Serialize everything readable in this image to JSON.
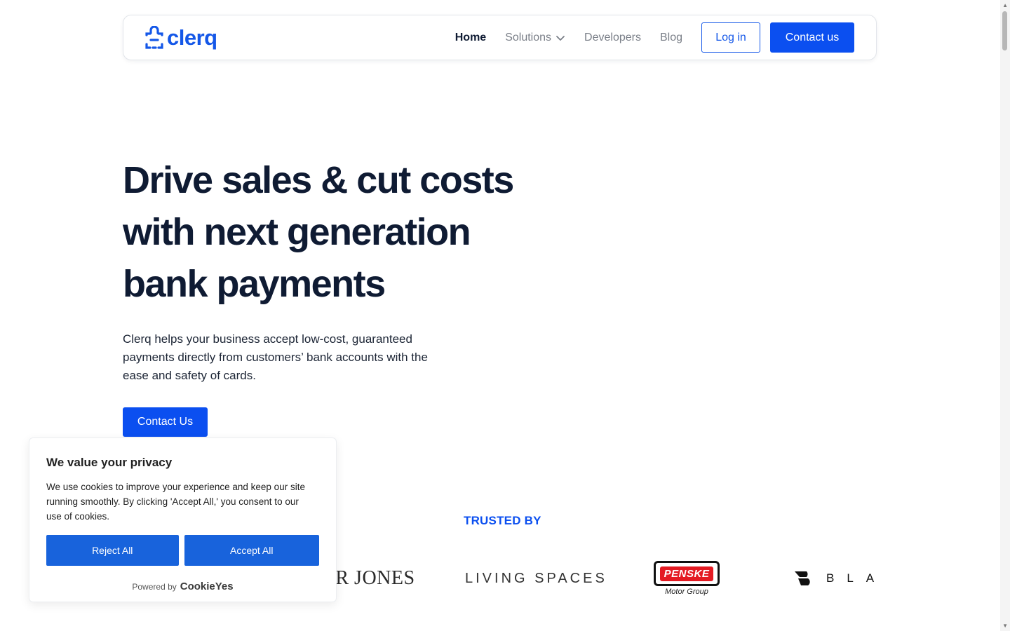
{
  "brand": {
    "name": "clerq",
    "color": "#1457e8"
  },
  "nav": {
    "links": [
      {
        "label": "Home",
        "active": true
      },
      {
        "label": "Solutions",
        "has_dropdown": true
      },
      {
        "label": "Developers"
      },
      {
        "label": "Blog"
      }
    ],
    "login_label": "Log in",
    "contact_label": "Contact us"
  },
  "hero": {
    "title_line1": "Drive sales & cut costs",
    "title_line2": "with next generation",
    "title_line3": "bank payments",
    "subtitle": "Clerq helps your business accept low-cost, guaranteed payments directly from customers’ bank accounts with the ease and safety of cards.",
    "cta_label": "Contact Us"
  },
  "trusted": {
    "heading": "TRUSTED BY",
    "logos": {
      "fletcher": "FLETCHER JONES",
      "living": "LIVING SPACES",
      "penske_main": "PENSKE",
      "penske_sub": "Motor Group",
      "blade": "BLADE"
    }
  },
  "cookie": {
    "title": "We value your privacy",
    "text": "We use cookies to improve your experience and keep our site running smoothly. By clicking 'Accept All,' you consent to our use of cookies.",
    "reject_label": "Reject All",
    "accept_label": "Accept All",
    "powered_by": "Powered by",
    "powered_brand": "CookieYes",
    "button_color": "#1863dc"
  },
  "colors": {
    "primary": "#0b4ff0",
    "heading": "#0f1b33",
    "muted": "#7a7f88"
  }
}
